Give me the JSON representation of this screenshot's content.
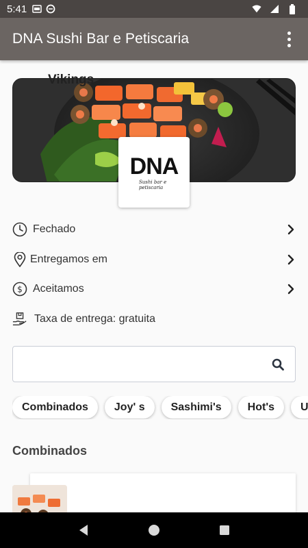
{
  "status_bar": {
    "time": "5:41"
  },
  "app_bar": {
    "title": "DNA Sushi Bar e Petiscaria",
    "menu_icon": "more-vert-icon"
  },
  "logo": {
    "main": "DNA",
    "sub": "Sushi bar e petiscaria"
  },
  "info": {
    "status": "Fechado",
    "delivery_area": "Entregamos em",
    "payment": "Aceitamos",
    "fee": "Taxa de entrega: gratuita"
  },
  "search": {
    "placeholder": "",
    "value": ""
  },
  "categories": [
    "Combinados",
    "Joy' s",
    "Sashimi's",
    "Hot's",
    "U"
  ],
  "section": {
    "title": "Combinados"
  },
  "products": [
    {
      "name": "Vikings"
    }
  ],
  "colors": {
    "app_bar": "#6b6562",
    "status_bar": "#4a4543",
    "background": "#fafafa"
  }
}
